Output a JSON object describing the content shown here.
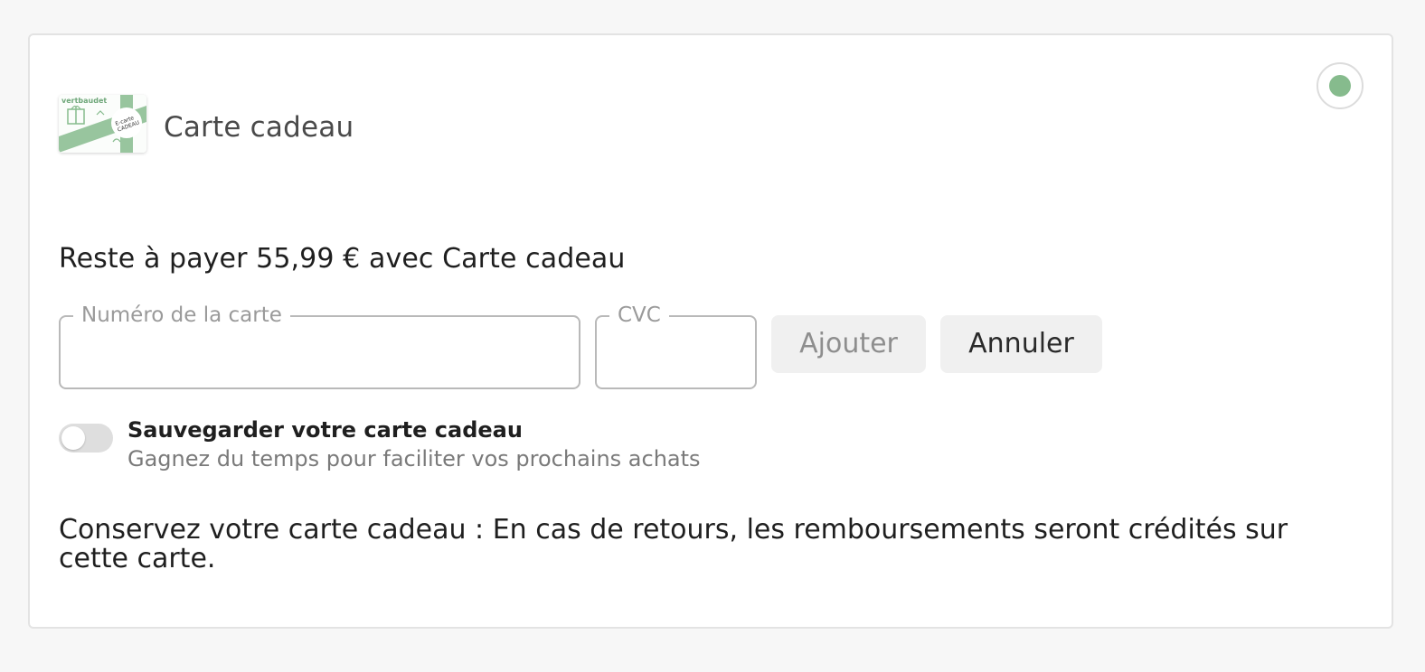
{
  "payment_method": {
    "title": "Carte cadeau",
    "thumbnail": {
      "brand_text": "vertbaudet",
      "tag_line1": "E-carte",
      "tag_line2": "CADEAU",
      "accent_color": "#86bb8d"
    },
    "selected": true
  },
  "remaining_text": "Reste à payer 55,99 € avec Carte cadeau",
  "form": {
    "card_number": {
      "label": "Numéro de la carte",
      "value": ""
    },
    "cvc": {
      "label": "CVC",
      "value": ""
    },
    "add_label": "Ajouter",
    "cancel_label": "Annuler"
  },
  "save_option": {
    "title": "Sauvegarder votre carte cadeau",
    "subtitle": "Gagnez du temps pour faciliter vos prochains achats",
    "enabled": false
  },
  "notice": "Conservez votre carte cadeau : En cas de retours, les remboursements seront crédités sur cette carte.",
  "colors": {
    "accent": "#86bb8d",
    "text": "#1f1f1f",
    "muted": "#7a7a7a"
  }
}
